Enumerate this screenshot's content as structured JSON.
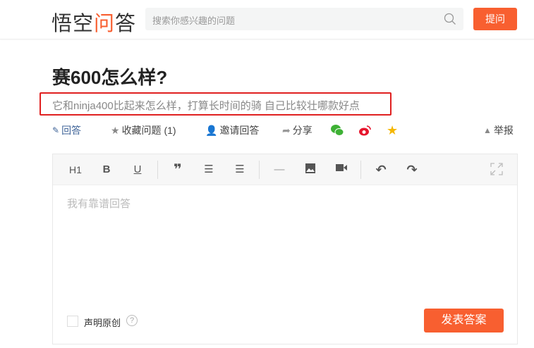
{
  "header": {
    "logo": {
      "part1": "悟空",
      "part2": "问",
      "part3": "答"
    },
    "search_placeholder": "搜索你感兴趣的问题",
    "ask_button": "提问"
  },
  "question": {
    "title": "赛600怎么样?",
    "description": "它和ninja400比起来怎么样，打算长时间的骑 自己比较壮哪款好点"
  },
  "actions": {
    "answer": "回答",
    "favorite": "收藏问题 (1)",
    "invite": "邀请回答",
    "share": "分享",
    "report": "举报"
  },
  "editor": {
    "toolbar": {
      "h1": "H1",
      "bold": "B",
      "underline": "U"
    },
    "placeholder": "我有靠谱回答",
    "original_label": "声明原创",
    "help": "?",
    "submit": "发表答案"
  },
  "colors": {
    "accent": "#f85f30",
    "highlight": "#e02020",
    "link": "#406599"
  }
}
